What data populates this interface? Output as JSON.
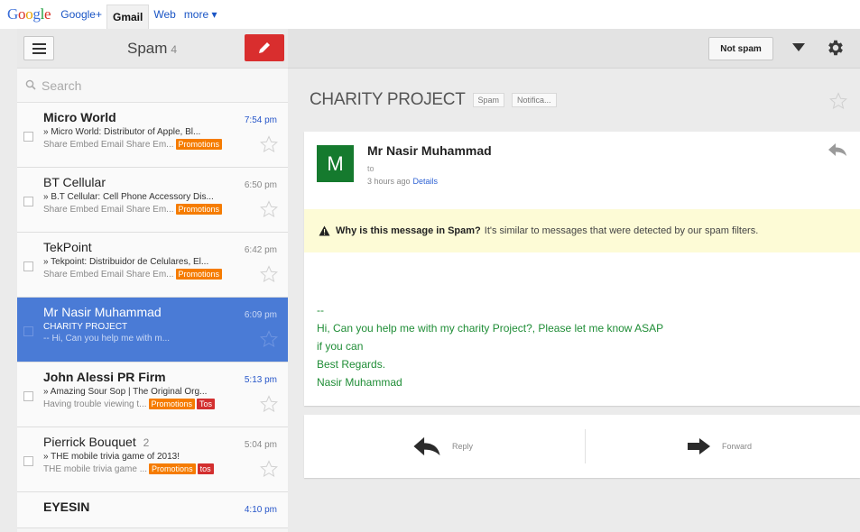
{
  "gbar": {
    "logo": "Google",
    "items": [
      "Google+",
      "Gmail",
      "Web",
      "more"
    ],
    "more_arrow": "▾"
  },
  "left": {
    "folder": "Spam",
    "folder_count": "4",
    "search_placeholder": "Search",
    "mails": [
      {
        "sender": "Micro World",
        "time": "7:54 pm",
        "subject": "» Micro World: Distributor of Apple, Bl...",
        "snippet": "Share Embed Email Share Em...",
        "tags": [
          "Promotions"
        ],
        "unread": true
      },
      {
        "sender": "BT Cellular",
        "time": "6:50 pm",
        "subject": "» B.T Cellular: Cell Phone Accessory Dis...",
        "snippet": "Share Embed Email Share Em...",
        "tags": [
          "Promotions"
        ],
        "unread": false
      },
      {
        "sender": "TekPoint",
        "time": "6:42 pm",
        "subject": "» Tekpoint: Distribuidor de Celulares, El...",
        "snippet": "Share Embed Email Share Em...",
        "tags": [
          "Promotions"
        ],
        "unread": false
      },
      {
        "sender": "Mr Nasir Muhammad",
        "time": "6:09 pm",
        "subject": "CHARITY PROJECT",
        "snippet": "-- Hi, Can you help me with m...",
        "tags": [],
        "unread": false,
        "selected": true
      },
      {
        "sender": "John Alessi PR Firm",
        "time": "5:13 pm",
        "subject": "» Amazing Sour Sop | The Original Org...",
        "snippet": "Having trouble viewing t...",
        "tags": [
          "Promotions",
          "Tos"
        ],
        "unread": true
      },
      {
        "sender": "Pierrick Bouquet",
        "sender_count": "2",
        "time": "5:04 pm",
        "subject": "» THE mobile trivia game of 2013!",
        "snippet": "THE mobile trivia game ...",
        "tags": [
          "Promotions",
          "tos"
        ],
        "unread": false
      },
      {
        "sender": "EYESIN",
        "time": "4:10 pm",
        "unread": true
      }
    ]
  },
  "toolbar": {
    "not_spam": "Not spam"
  },
  "thread": {
    "subject": "CHARITY PROJECT",
    "labels": [
      "Spam",
      "Notifica..."
    ],
    "from": "Mr Nasir Muhammad",
    "avatar_letter": "M",
    "to": "to",
    "when": "3 hours ago",
    "details": "Details",
    "warning_bold": "Why is this message in Spam?",
    "warning_text": "It's similar to messages that were detected by our spam filters.",
    "body": [
      "--",
      "Hi, Can you help me with my charity Project?, Please let me know ASAP",
      "if you can",
      "Best Regards.",
      "Nasir Muhammad"
    ],
    "reply": "Reply",
    "forward": "Forward"
  },
  "colors": {
    "selected_row": "#4a7bd6",
    "compose": "#d92e2e",
    "promotions_tag": "#f57c00",
    "avatar": "#157a2e",
    "body_text": "#1f8d36",
    "warning_bg": "#fdfbd6"
  },
  "icons": {
    "menu": "menu-icon",
    "compose": "pencil-icon",
    "search": "search-icon",
    "star": "star-icon",
    "dropdown": "caret-down-icon",
    "settings": "gear-icon",
    "reply": "reply-arrow-icon",
    "forward": "forward-arrow-icon",
    "warning": "warning-triangle-icon"
  }
}
